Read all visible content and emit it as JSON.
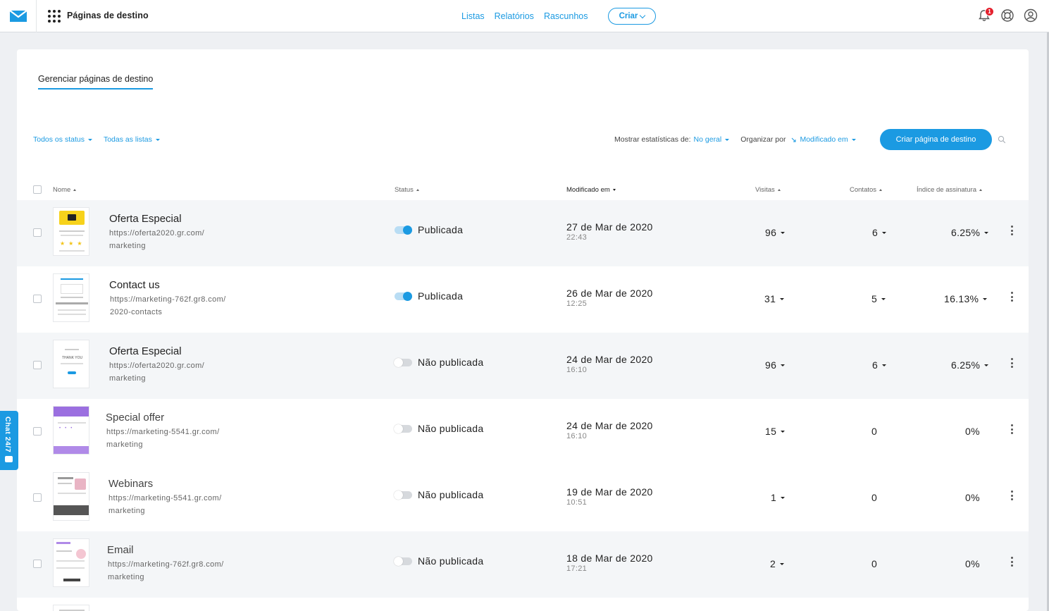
{
  "app": {
    "title": "Páginas de destino"
  },
  "nav": {
    "items": [
      "Listas",
      "Relatórios",
      "Rascunhos"
    ],
    "create_label": "Criar",
    "notification_count": "1"
  },
  "tab": {
    "label": "Gerenciar páginas de destino"
  },
  "filters": {
    "status": "Todos os status",
    "lists": "Todas as listas",
    "stats_label": "Mostrar estatísticas de:",
    "stats_value": "No geral",
    "sort_label": "Organizar por",
    "sort_value": "Modificado em"
  },
  "create_page_button": "Criar página de destino",
  "columns": {
    "name": "Nome",
    "status": "Status",
    "modified": "Modificado em",
    "visits": "Visitas",
    "contacts": "Contatos",
    "signup_rate": "Índice de assinatura"
  },
  "rows": [
    {
      "name": "Oferta Especial",
      "url1": "https://oferta2020.gr.com/",
      "url2": "marketing",
      "status": "Publicada",
      "published": true,
      "date": "27 de Mar de 2020",
      "time": "22:43",
      "visits": "96",
      "contacts": "6",
      "rate": "6.25%"
    },
    {
      "name": "Contact us",
      "url1": "https://marketing-762f.gr8.com/",
      "url2": "2020-contacts",
      "status": "Publicada",
      "published": true,
      "date": "26 de Mar de 2020",
      "time": "12:25",
      "visits": "31",
      "contacts": "5",
      "rate": "16.13%"
    },
    {
      "name": "Oferta Especial",
      "url1": "https://oferta2020.gr.com/",
      "url2": "marketing",
      "status": "Não publicada",
      "published": false,
      "date": "24 de Mar de 2020",
      "time": "16:10",
      "visits": "96",
      "contacts": "6",
      "rate": "6.25%"
    },
    {
      "name": "Special offer",
      "url1": "https://marketing-5541.gr.com/",
      "url2": "marketing",
      "status": "Não publicada",
      "published": false,
      "date": "24 de Mar de 2020",
      "time": "16:10",
      "visits": "15",
      "contacts": "0",
      "rate": "0%"
    },
    {
      "name": "Webinars",
      "url1": "https://marketing-5541.gr.com/",
      "url2": "marketing",
      "status": "Não publicada",
      "published": false,
      "date": "19 de Mar de 2020",
      "time": "10:51",
      "visits": "1",
      "contacts": "0",
      "rate": "0%"
    },
    {
      "name": "Email",
      "url1": "https://marketing-762f.gr8.com/",
      "url2": "marketing",
      "status": "Não publicada",
      "published": false,
      "date": "18 de Mar de 2020",
      "time": "17:21",
      "visits": "2",
      "contacts": "0",
      "rate": "0%"
    }
  ],
  "chat": {
    "label": "Chat 24/7"
  },
  "colors": {
    "accent": "#1b9ae2",
    "badge": "#e4202d"
  }
}
